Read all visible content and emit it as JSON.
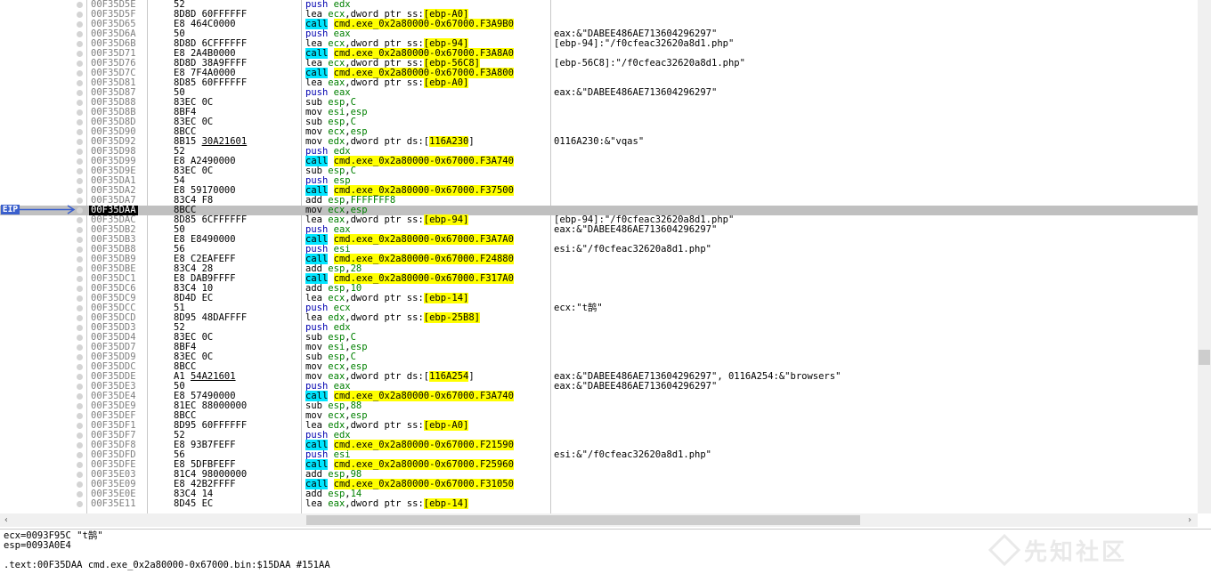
{
  "eip_label": "EIP",
  "rows": [
    {
      "a": "00F35D5E",
      "b": "52",
      "i": [
        [
          "push",
          "mn-push"
        ],
        [
          " "
        ],
        [
          "edx",
          "reg"
        ]
      ],
      "c": ""
    },
    {
      "a": "00F35D5F",
      "b": "8D8D 60FFFFFF",
      "i": [
        [
          "lea",
          "mn-lea"
        ],
        [
          " "
        ],
        [
          "ecx",
          "reg"
        ],
        [
          ",dword ptr ss:"
        ],
        [
          "[ebp-A0]",
          "brk"
        ]
      ],
      "c": ""
    },
    {
      "a": "00F35D65",
      "b": "E8 464C0000",
      "i": [
        [
          "call",
          "mn-call"
        ],
        [
          " "
        ],
        [
          "cmd.exe_0x2a80000-0x67000.F3A9B0",
          "op-call"
        ]
      ],
      "c": ""
    },
    {
      "a": "00F35D6A",
      "b": "50",
      "i": [
        [
          "push",
          "mn-push"
        ],
        [
          " "
        ],
        [
          "eax",
          "reg"
        ]
      ],
      "c": "eax:&\"DABEE486AE713604296297\""
    },
    {
      "a": "00F35D6B",
      "b": "8D8D 6CFFFFFF",
      "i": [
        [
          "lea",
          "mn-lea"
        ],
        [
          " "
        ],
        [
          "ecx",
          "reg"
        ],
        [
          ",dword ptr ss:"
        ],
        [
          "[ebp-94]",
          "brk"
        ]
      ],
      "c": "[ebp-94]:\"/f0cfeac32620a8d1.php\""
    },
    {
      "a": "00F35D71",
      "b": "E8 2A4B0000",
      "i": [
        [
          "call",
          "mn-call"
        ],
        [
          " "
        ],
        [
          "cmd.exe_0x2a80000-0x67000.F3A8A0",
          "op-call"
        ]
      ],
      "c": ""
    },
    {
      "a": "00F35D76",
      "b": "8D8D 38A9FFFF",
      "i": [
        [
          "lea",
          "mn-lea"
        ],
        [
          " "
        ],
        [
          "ecx",
          "reg"
        ],
        [
          ",dword ptr ss:"
        ],
        [
          "[ebp-56C8]",
          "brk"
        ]
      ],
      "c": "[ebp-56C8]:\"/f0cfeac32620a8d1.php\""
    },
    {
      "a": "00F35D7C",
      "b": "E8 7F4A0000",
      "i": [
        [
          "call",
          "mn-call"
        ],
        [
          " "
        ],
        [
          "cmd.exe_0x2a80000-0x67000.F3A800",
          "op-call"
        ]
      ],
      "c": ""
    },
    {
      "a": "00F35D81",
      "b": "8D85 60FFFFFF",
      "i": [
        [
          "lea",
          "mn-lea"
        ],
        [
          " "
        ],
        [
          "eax",
          "reg"
        ],
        [
          ",dword ptr ss:"
        ],
        [
          "[ebp-A0]",
          "brk"
        ]
      ],
      "c": ""
    },
    {
      "a": "00F35D87",
      "b": "50",
      "i": [
        [
          "push",
          "mn-push"
        ],
        [
          " "
        ],
        [
          "eax",
          "reg"
        ]
      ],
      "c": "eax:&\"DABEE486AE713604296297\""
    },
    {
      "a": "00F35D88",
      "b": "83EC 0C",
      "i": [
        [
          "sub",
          "mn-sub"
        ],
        [
          " "
        ],
        [
          "esp",
          "reg"
        ],
        [
          ","
        ],
        [
          "C",
          "num"
        ]
      ],
      "c": ""
    },
    {
      "a": "00F35D8B",
      "b": "8BF4",
      "i": [
        [
          "mov",
          "mn-mov"
        ],
        [
          " "
        ],
        [
          "esi",
          "reg"
        ],
        [
          ","
        ],
        [
          "esp",
          "reg"
        ]
      ],
      "c": ""
    },
    {
      "a": "00F35D8D",
      "b": "83EC 0C",
      "i": [
        [
          "sub",
          "mn-sub"
        ],
        [
          " "
        ],
        [
          "esp",
          "reg"
        ],
        [
          ","
        ],
        [
          "C",
          "num"
        ]
      ],
      "c": ""
    },
    {
      "a": "00F35D90",
      "b": "8BCC",
      "i": [
        [
          "mov",
          "mn-mov"
        ],
        [
          " "
        ],
        [
          "ecx",
          "reg"
        ],
        [
          ","
        ],
        [
          "esp",
          "reg"
        ]
      ],
      "c": ""
    },
    {
      "a": "00F35D92",
      "b": "8B15 ",
      "bu": "30A21601",
      "i": [
        [
          "mov",
          "mn-mov"
        ],
        [
          " "
        ],
        [
          "edx",
          "reg"
        ],
        [
          ",dword ptr ds:["
        ],
        [
          "116A230",
          "brk"
        ],
        [
          "]"
        ]
      ],
      "c": "0116A230:&\"vqas\""
    },
    {
      "a": "00F35D98",
      "b": "52",
      "i": [
        [
          "push",
          "mn-push"
        ],
        [
          " "
        ],
        [
          "edx",
          "reg"
        ]
      ],
      "c": ""
    },
    {
      "a": "00F35D99",
      "b": "E8 A2490000",
      "i": [
        [
          "call",
          "mn-call"
        ],
        [
          " "
        ],
        [
          "cmd.exe_0x2a80000-0x67000.F3A740",
          "op-call"
        ]
      ],
      "c": ""
    },
    {
      "a": "00F35D9E",
      "b": "83EC 0C",
      "i": [
        [
          "sub",
          "mn-sub"
        ],
        [
          " "
        ],
        [
          "esp",
          "reg"
        ],
        [
          ","
        ],
        [
          "C",
          "num"
        ]
      ],
      "c": ""
    },
    {
      "a": "00F35DA1",
      "b": "54",
      "i": [
        [
          "push",
          "mn-push"
        ],
        [
          " "
        ],
        [
          "esp",
          "reg"
        ]
      ],
      "c": ""
    },
    {
      "a": "00F35DA2",
      "b": "E8 59170000",
      "i": [
        [
          "call",
          "mn-call"
        ],
        [
          " "
        ],
        [
          "cmd.exe_0x2a80000-0x67000.F37500",
          "op-call"
        ]
      ],
      "c": ""
    },
    {
      "a": "00F35DA7",
      "b": "83C4 F8",
      "i": [
        [
          "add",
          "mn-add"
        ],
        [
          " "
        ],
        [
          "esp",
          "reg"
        ],
        [
          ","
        ],
        [
          "FFFFFFF8",
          "num"
        ]
      ],
      "c": ""
    },
    {
      "a": "00F35DAA",
      "b": "8BCC",
      "sel": true,
      "i": [
        [
          "mov",
          "mn-mov"
        ],
        [
          " "
        ],
        [
          "ecx",
          "reg"
        ],
        [
          ","
        ],
        [
          "esp",
          "reg"
        ]
      ],
      "c": ""
    },
    {
      "a": "00F35DAC",
      "b": "8D85 6CFFFFFF",
      "i": [
        [
          "lea",
          "mn-lea"
        ],
        [
          " "
        ],
        [
          "eax",
          "reg"
        ],
        [
          ",dword ptr ss:"
        ],
        [
          "[ebp-94]",
          "brk"
        ]
      ],
      "c": "[ebp-94]:\"/f0cfeac32620a8d1.php\""
    },
    {
      "a": "00F35DB2",
      "b": "50",
      "i": [
        [
          "push",
          "mn-push"
        ],
        [
          " "
        ],
        [
          "eax",
          "reg"
        ]
      ],
      "c": "eax:&\"DABEE486AE713604296297\""
    },
    {
      "a": "00F35DB3",
      "b": "E8 E8490000",
      "i": [
        [
          "call",
          "mn-call"
        ],
        [
          " "
        ],
        [
          "cmd.exe_0x2a80000-0x67000.F3A7A0",
          "op-call"
        ]
      ],
      "c": ""
    },
    {
      "a": "00F35DB8",
      "b": "56",
      "i": [
        [
          "push",
          "mn-push"
        ],
        [
          " "
        ],
        [
          "esi",
          "reg"
        ]
      ],
      "c": "esi:&\"/f0cfeac32620a8d1.php\""
    },
    {
      "a": "00F35DB9",
      "b": "E8 C2EAFEFF",
      "i": [
        [
          "call",
          "mn-call"
        ],
        [
          " "
        ],
        [
          "cmd.exe_0x2a80000-0x67000.F24880",
          "op-call"
        ]
      ],
      "c": ""
    },
    {
      "a": "00F35DBE",
      "b": "83C4 28",
      "i": [
        [
          "add",
          "mn-add"
        ],
        [
          " "
        ],
        [
          "esp",
          "reg"
        ],
        [
          ","
        ],
        [
          "28",
          "num"
        ]
      ],
      "c": ""
    },
    {
      "a": "00F35DC1",
      "b": "E8 DAB9FFFF",
      "i": [
        [
          "call",
          "mn-call"
        ],
        [
          " "
        ],
        [
          "cmd.exe_0x2a80000-0x67000.F317A0",
          "op-call"
        ]
      ],
      "c": ""
    },
    {
      "a": "00F35DC6",
      "b": "83C4 10",
      "i": [
        [
          "add",
          "mn-add"
        ],
        [
          " "
        ],
        [
          "esp",
          "reg"
        ],
        [
          ","
        ],
        [
          "10",
          "num"
        ]
      ],
      "c": ""
    },
    {
      "a": "00F35DC9",
      "b": "8D4D EC",
      "i": [
        [
          "lea",
          "mn-lea"
        ],
        [
          " "
        ],
        [
          "ecx",
          "reg"
        ],
        [
          ",dword ptr ss:"
        ],
        [
          "[ebp-14]",
          "brk"
        ]
      ],
      "c": ""
    },
    {
      "a": "00F35DCC",
      "b": "51",
      "i": [
        [
          "push",
          "mn-push"
        ],
        [
          " "
        ],
        [
          "ecx",
          "reg"
        ]
      ],
      "c": "ecx:\"t鹄\""
    },
    {
      "a": "00F35DCD",
      "b": "8D95 48DAFFFF",
      "i": [
        [
          "lea",
          "mn-lea"
        ],
        [
          " "
        ],
        [
          "edx",
          "reg"
        ],
        [
          ",dword ptr ss:"
        ],
        [
          "[ebp-25B8]",
          "brk"
        ]
      ],
      "c": ""
    },
    {
      "a": "00F35DD3",
      "b": "52",
      "i": [
        [
          "push",
          "mn-push"
        ],
        [
          " "
        ],
        [
          "edx",
          "reg"
        ]
      ],
      "c": ""
    },
    {
      "a": "00F35DD4",
      "b": "83EC 0C",
      "i": [
        [
          "sub",
          "mn-sub"
        ],
        [
          " "
        ],
        [
          "esp",
          "reg"
        ],
        [
          ","
        ],
        [
          "C",
          "num"
        ]
      ],
      "c": ""
    },
    {
      "a": "00F35DD7",
      "b": "8BF4",
      "i": [
        [
          "mov",
          "mn-mov"
        ],
        [
          " "
        ],
        [
          "esi",
          "reg"
        ],
        [
          ","
        ],
        [
          "esp",
          "reg"
        ]
      ],
      "c": ""
    },
    {
      "a": "00F35DD9",
      "b": "83EC 0C",
      "i": [
        [
          "sub",
          "mn-sub"
        ],
        [
          " "
        ],
        [
          "esp",
          "reg"
        ],
        [
          ","
        ],
        [
          "C",
          "num"
        ]
      ],
      "c": ""
    },
    {
      "a": "00F35DDC",
      "b": "8BCC",
      "i": [
        [
          "mov",
          "mn-mov"
        ],
        [
          " "
        ],
        [
          "ecx",
          "reg"
        ],
        [
          ","
        ],
        [
          "esp",
          "reg"
        ]
      ],
      "c": ""
    },
    {
      "a": "00F35DDE",
      "b": "A1 ",
      "bu": "54A21601",
      "i": [
        [
          "mov",
          "mn-mov"
        ],
        [
          " "
        ],
        [
          "eax",
          "reg"
        ],
        [
          ",dword ptr ds:["
        ],
        [
          "116A254",
          "brk"
        ],
        [
          "]"
        ]
      ],
      "c": "eax:&\"DABEE486AE713604296297\", 0116A254:&\"browsers\""
    },
    {
      "a": "00F35DE3",
      "b": "50",
      "i": [
        [
          "push",
          "mn-push"
        ],
        [
          " "
        ],
        [
          "eax",
          "reg"
        ]
      ],
      "c": "eax:&\"DABEE486AE713604296297\""
    },
    {
      "a": "00F35DE4",
      "b": "E8 57490000",
      "i": [
        [
          "call",
          "mn-call"
        ],
        [
          " "
        ],
        [
          "cmd.exe_0x2a80000-0x67000.F3A740",
          "op-call"
        ]
      ],
      "c": ""
    },
    {
      "a": "00F35DE9",
      "b": "81EC 88000000",
      "i": [
        [
          "sub",
          "mn-sub"
        ],
        [
          " "
        ],
        [
          "esp",
          "reg"
        ],
        [
          ","
        ],
        [
          "88",
          "num"
        ]
      ],
      "c": ""
    },
    {
      "a": "00F35DEF",
      "b": "8BCC",
      "i": [
        [
          "mov",
          "mn-mov"
        ],
        [
          " "
        ],
        [
          "ecx",
          "reg"
        ],
        [
          ","
        ],
        [
          "esp",
          "reg"
        ]
      ],
      "c": ""
    },
    {
      "a": "00F35DF1",
      "b": "8D95 60FFFFFF",
      "i": [
        [
          "lea",
          "mn-lea"
        ],
        [
          " "
        ],
        [
          "edx",
          "reg"
        ],
        [
          ",dword ptr ss:"
        ],
        [
          "[ebp-A0]",
          "brk"
        ]
      ],
      "c": ""
    },
    {
      "a": "00F35DF7",
      "b": "52",
      "i": [
        [
          "push",
          "mn-push"
        ],
        [
          " "
        ],
        [
          "edx",
          "reg"
        ]
      ],
      "c": ""
    },
    {
      "a": "00F35DF8",
      "b": "E8 93B7FEFF",
      "i": [
        [
          "call",
          "mn-call"
        ],
        [
          " "
        ],
        [
          "cmd.exe_0x2a80000-0x67000.F21590",
          "op-call"
        ]
      ],
      "c": ""
    },
    {
      "a": "00F35DFD",
      "b": "56",
      "i": [
        [
          "push",
          "mn-push"
        ],
        [
          " "
        ],
        [
          "esi",
          "reg"
        ]
      ],
      "c": "esi:&\"/f0cfeac32620a8d1.php\""
    },
    {
      "a": "00F35DFE",
      "b": "E8 5DFBFEFF",
      "i": [
        [
          "call",
          "mn-call"
        ],
        [
          " "
        ],
        [
          "cmd.exe_0x2a80000-0x67000.F25960",
          "op-call"
        ]
      ],
      "c": ""
    },
    {
      "a": "00F35E03",
      "b": "81C4 98000000",
      "i": [
        [
          "add",
          "mn-add"
        ],
        [
          " "
        ],
        [
          "esp",
          "reg"
        ],
        [
          ","
        ],
        [
          "98",
          "num"
        ]
      ],
      "c": ""
    },
    {
      "a": "00F35E09",
      "b": "E8 42B2FFFF",
      "i": [
        [
          "call",
          "mn-call"
        ],
        [
          " "
        ],
        [
          "cmd.exe_0x2a80000-0x67000.F31050",
          "op-call"
        ]
      ],
      "c": ""
    },
    {
      "a": "00F35E0E",
      "b": "83C4 14",
      "i": [
        [
          "add",
          "mn-add"
        ],
        [
          " "
        ],
        [
          "esp",
          "reg"
        ],
        [
          ","
        ],
        [
          "14",
          "num"
        ]
      ],
      "c": ""
    },
    {
      "a": "00F35E11",
      "b": "8D45 EC",
      "i": [
        [
          "lea",
          "mn-lea"
        ],
        [
          " "
        ],
        [
          "eax",
          "reg"
        ],
        [
          ",dword ptr ss:"
        ],
        [
          "[ebp-14]",
          "brk"
        ]
      ],
      "c": ""
    }
  ],
  "info": {
    "line1": "ecx=0093F95C \"t鹄\"",
    "line2": "esp=0093A0E4",
    "line3": ".text:00F35DAA cmd.exe_0x2a80000-0x67000.bin:$15DAA #151AA"
  },
  "watermark": "先知社区",
  "colors": {
    "eip_badge": "#3a5fcd",
    "call_mnemonic": "#00e5ff",
    "highlight": "#ffff00",
    "selection": "#c0c0c0"
  },
  "icons": {
    "eip_arrow": "arrow-right-icon",
    "scroll_left": "chevron-left-icon",
    "scroll_right": "chevron-right-icon"
  }
}
